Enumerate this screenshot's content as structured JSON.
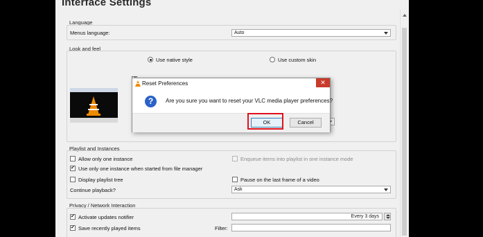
{
  "page_title": "Interface Settings",
  "language": {
    "group_label": "Language",
    "menus_language_label": "Menus language:",
    "menus_language_value": "Auto"
  },
  "look_and_feel": {
    "group_label": "Look and feel",
    "native_style_label": "Use native style",
    "custom_skin_label": "Use custom skin"
  },
  "playlist": {
    "group_label": "Playlist and Instances",
    "allow_one_instance": "Allow only one instance",
    "one_instance_file_manager": "Use only one instance when started from file manager",
    "display_playlist_tree": "Display playlist tree",
    "enqueue_items": "Enqueue items into playlist in one instance mode",
    "pause_last_frame": "Pause on the last frame of a video",
    "continue_playback_label": "Continue playback?",
    "continue_playback_value": "Ask"
  },
  "privacy": {
    "group_label": "Privacy / Network Interaction",
    "activate_updates": "Activate updates notifier",
    "updates_frequency": "Every 3 days",
    "save_recent": "Save recently played items",
    "filter_label": "Filter:"
  },
  "dialog": {
    "title": "Reset Preferences",
    "close_glyph": "✕",
    "question_glyph": "?",
    "message": "Are you sure you want to reset your VLC media player preferences?",
    "ok_label": "OK",
    "cancel_label": "Cancel"
  }
}
